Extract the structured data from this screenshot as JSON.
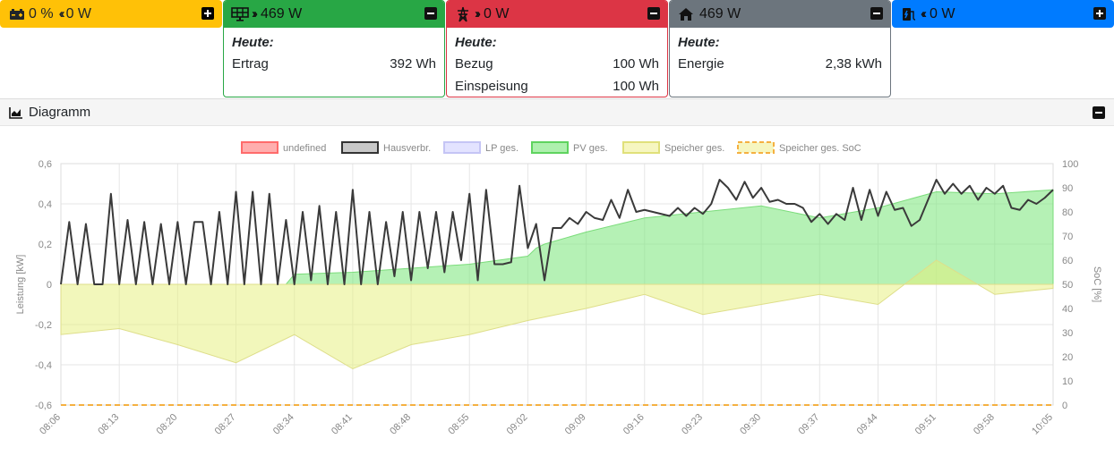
{
  "battery": {
    "soc": "0 %",
    "power": "0 W"
  },
  "pv": {
    "power": "469 W",
    "today_label": "Heute:",
    "yield_label": "Ertrag",
    "yield_value": "392 Wh"
  },
  "grid": {
    "power": "0 W",
    "today_label": "Heute:",
    "import_label": "Bezug",
    "import_value": "100 Wh",
    "export_label": "Einspeisung",
    "export_value": "100 Wh"
  },
  "house": {
    "power": "469 W",
    "today_label": "Heute:",
    "energy_label": "Energie",
    "energy_value": "2,38 kWh"
  },
  "chargepoint": {
    "power": "0 W"
  },
  "diagram": {
    "title": "Diagramm"
  },
  "colors": {
    "battery": "#ffc107",
    "pv": "#28a745",
    "grid": "#dc3545",
    "house": "#6c757d",
    "chargepoint": "#007bff"
  },
  "chart_data": {
    "type": "area",
    "legend_position": "top",
    "legend": [
      "undefined",
      "Hausverbr.",
      "LP ges.",
      "PV ges.",
      "Speicher ges.",
      "Speicher ges. SoC"
    ],
    "ylabel": "Leistung [kW]",
    "y2label": "SoC [%]",
    "ylim": [
      -0.6,
      0.6
    ],
    "y2lim": [
      0,
      100
    ],
    "yticks": [
      "0,6",
      "0,4",
      "0,2",
      "0",
      "-0,2",
      "-0,4",
      "-0,6"
    ],
    "y2ticks": [
      "100",
      "90",
      "80",
      "70",
      "60",
      "50",
      "40",
      "30",
      "20",
      "10",
      "0"
    ],
    "xticks": [
      "08:06",
      "08:13",
      "08:20",
      "08:27",
      "08:34",
      "08:41",
      "08:48",
      "08:55",
      "09:02",
      "09:09",
      "09:16",
      "09:23",
      "09:30",
      "09:37",
      "09:44",
      "09:51",
      "09:58",
      "10:05"
    ],
    "series": [
      {
        "name": "Hausverbr.",
        "x": [
          "08:06",
          "08:07",
          "08:08",
          "08:09",
          "08:10",
          "08:11",
          "08:12",
          "08:13",
          "08:14",
          "08:15",
          "08:16",
          "08:17",
          "08:18",
          "08:19",
          "08:20",
          "08:21",
          "08:22",
          "08:23",
          "08:24",
          "08:25",
          "08:26",
          "08:27",
          "08:28",
          "08:29",
          "08:30",
          "08:31",
          "08:32",
          "08:33",
          "08:34",
          "08:35",
          "08:36",
          "08:37",
          "08:38",
          "08:39",
          "08:40",
          "08:41",
          "08:42",
          "08:43",
          "08:44",
          "08:45",
          "08:46",
          "08:47",
          "08:48",
          "08:49",
          "08:50",
          "08:51",
          "08:52",
          "08:53",
          "08:54",
          "08:55",
          "08:56",
          "08:57",
          "08:58",
          "08:59",
          "09:00",
          "09:01",
          "09:02",
          "09:03",
          "09:04",
          "09:05",
          "09:06",
          "09:07",
          "09:08",
          "09:09",
          "09:10",
          "09:11",
          "09:12",
          "09:13",
          "09:14",
          "09:15",
          "09:16",
          "09:17",
          "09:18",
          "09:19",
          "09:20",
          "09:21",
          "09:22",
          "09:23",
          "09:24",
          "09:25",
          "09:26",
          "09:27",
          "09:28",
          "09:29",
          "09:30",
          "09:31",
          "09:32",
          "09:33",
          "09:34",
          "09:35",
          "09:36",
          "09:37",
          "09:38",
          "09:39",
          "09:40",
          "09:41",
          "09:42",
          "09:43",
          "09:44",
          "09:45",
          "09:46",
          "09:47",
          "09:48",
          "09:49",
          "09:50",
          "09:51",
          "09:52",
          "09:53",
          "09:54",
          "09:55",
          "09:56",
          "09:57",
          "09:58",
          "09:59",
          "10:00",
          "10:01",
          "10:02",
          "10:03",
          "10:04",
          "10:05"
        ],
        "values": [
          0.0,
          0.31,
          0.0,
          0.3,
          0.0,
          0.0,
          0.45,
          0.0,
          0.32,
          0.0,
          0.31,
          0.0,
          0.3,
          0.0,
          0.31,
          0.0,
          0.31,
          0.31,
          0.0,
          0.36,
          0.0,
          0.46,
          0.0,
          0.46,
          0.0,
          0.45,
          0.0,
          0.32,
          0.0,
          0.36,
          0.02,
          0.39,
          0.0,
          0.36,
          0.0,
          0.47,
          0.0,
          0.36,
          0.0,
          0.31,
          0.04,
          0.36,
          0.02,
          0.36,
          0.08,
          0.36,
          0.06,
          0.36,
          0.12,
          0.45,
          0.02,
          0.47,
          0.1,
          0.1,
          0.11,
          0.49,
          0.18,
          0.3,
          0.02,
          0.28,
          0.28,
          0.33,
          0.3,
          0.36,
          0.33,
          0.32,
          0.42,
          0.33,
          0.47,
          0.36,
          0.37,
          0.36,
          0.35,
          0.34,
          0.38,
          0.34,
          0.38,
          0.35,
          0.4,
          0.52,
          0.48,
          0.42,
          0.51,
          0.43,
          0.48,
          0.41,
          0.42,
          0.4,
          0.4,
          0.38,
          0.31,
          0.35,
          0.3,
          0.35,
          0.32,
          0.48,
          0.32,
          0.47,
          0.34,
          0.46,
          0.37,
          0.38,
          0.29,
          0.32,
          0.42,
          0.52,
          0.45,
          0.5,
          0.45,
          0.49,
          0.42,
          0.48,
          0.45,
          0.49,
          0.38,
          0.37,
          0.42,
          0.4,
          0.43,
          0.47
        ]
      },
      {
        "name": "PV ges.",
        "x": [
          "08:06",
          "08:33",
          "08:34",
          "08:41",
          "08:48",
          "08:55",
          "09:02",
          "09:03",
          "09:04",
          "09:09",
          "09:16",
          "09:23",
          "09:30",
          "09:37",
          "09:44",
          "09:51",
          "09:58",
          "10:05"
        ],
        "values": [
          0.0,
          0.0,
          0.05,
          0.06,
          0.08,
          0.1,
          0.14,
          0.18,
          0.2,
          0.26,
          0.33,
          0.36,
          0.39,
          0.33,
          0.38,
          0.46,
          0.45,
          0.47
        ]
      },
      {
        "name": "Speicher ges.",
        "x": [
          "08:06",
          "08:13",
          "08:20",
          "08:27",
          "08:34",
          "08:41",
          "08:48",
          "08:55",
          "09:02",
          "09:09",
          "09:16",
          "09:23",
          "09:30",
          "09:37",
          "09:44",
          "09:51",
          "09:58",
          "10:05"
        ],
        "values": [
          -0.25,
          -0.22,
          -0.3,
          -0.39,
          -0.25,
          -0.42,
          -0.3,
          -0.25,
          -0.18,
          -0.12,
          -0.05,
          -0.15,
          -0.1,
          -0.05,
          -0.1,
          0.12,
          -0.05,
          -0.02
        ]
      },
      {
        "name": "Speicher ges. SoC",
        "x": [
          "08:06",
          "08:13",
          "08:20",
          "08:27",
          "08:34",
          "08:41",
          "08:48",
          "08:55",
          "09:02",
          "09:09",
          "09:16",
          "09:23",
          "09:30",
          "09:37",
          "09:44",
          "09:51",
          "09:58",
          "10:05"
        ],
        "values": [
          0,
          0,
          0,
          0,
          0,
          0,
          0,
          0,
          0,
          0,
          0,
          0,
          0,
          0,
          0,
          0,
          0,
          0
        ]
      }
    ]
  }
}
